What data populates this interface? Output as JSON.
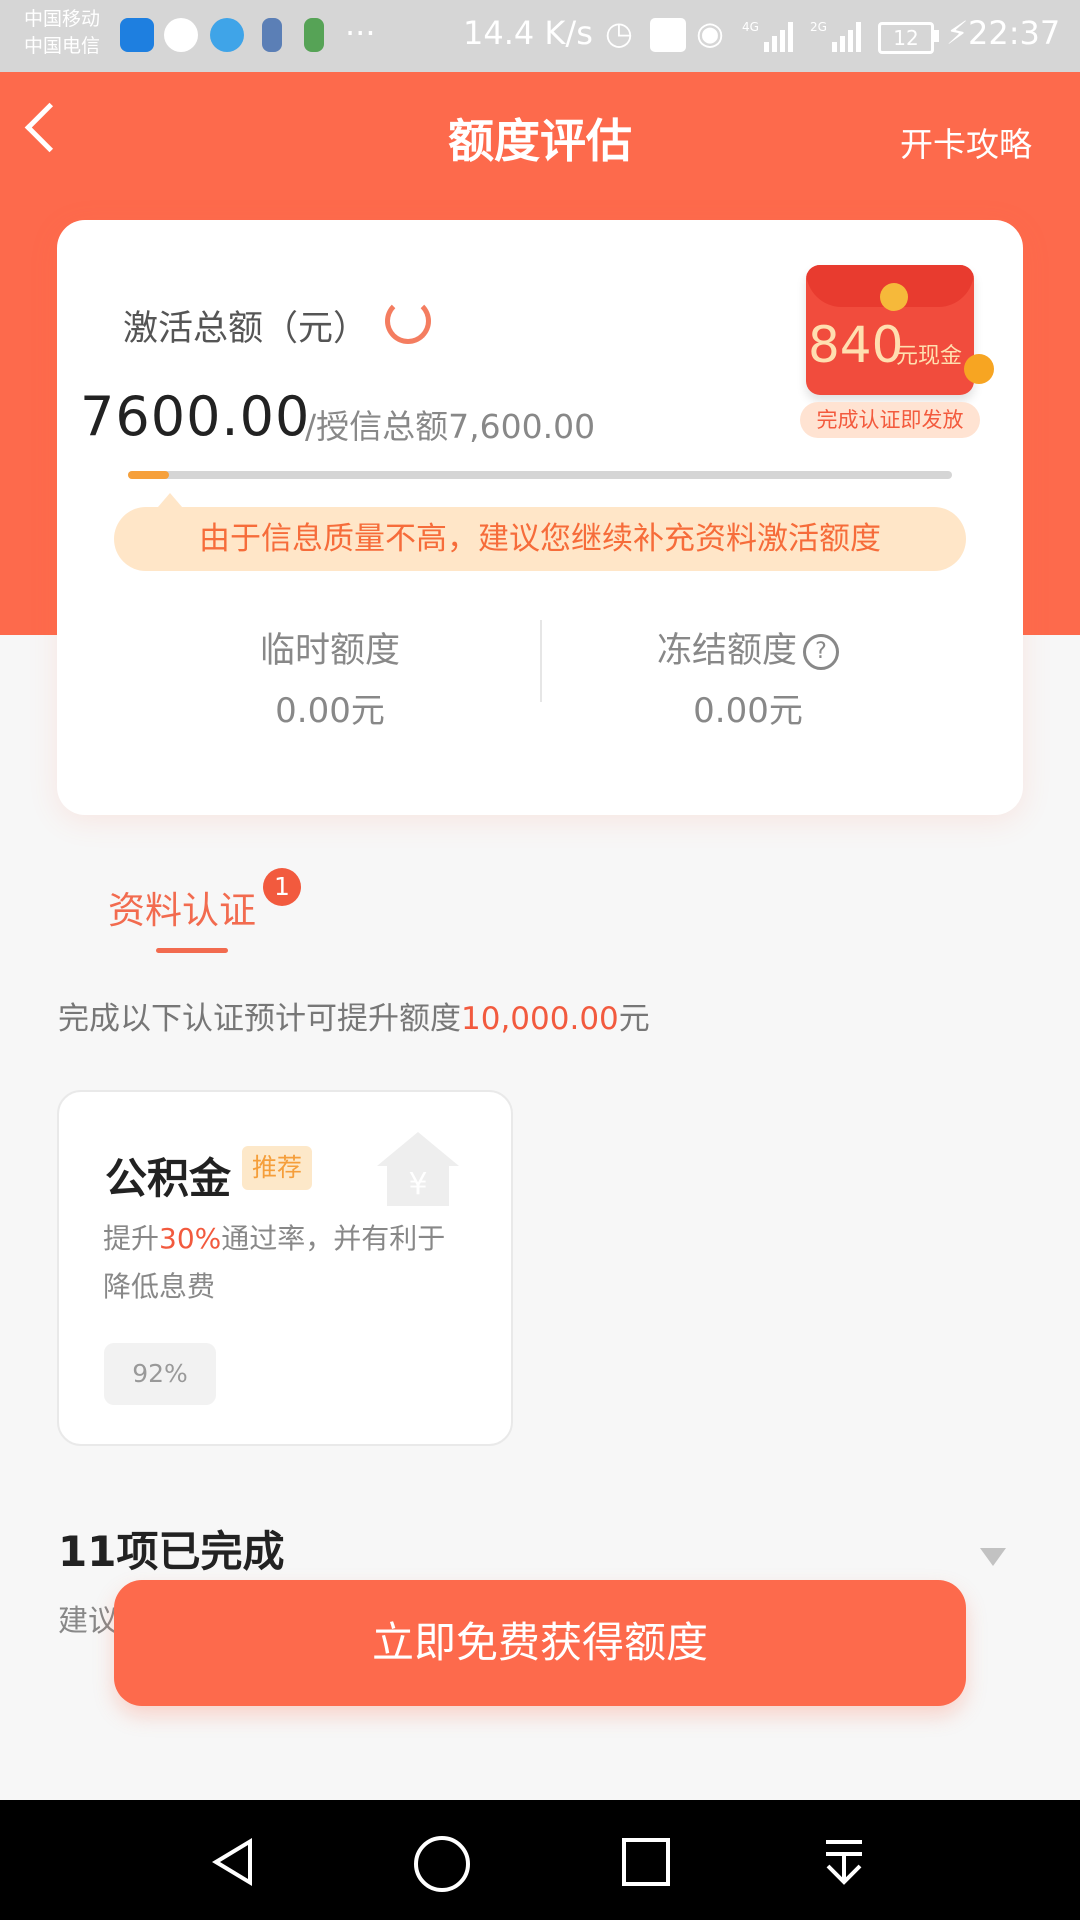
{
  "status_bar": {
    "carrier_1": "中国移动",
    "carrier_2": "中国电信",
    "network_speed": "14.4 K/s",
    "battery": "12",
    "time": "22:37",
    "signal_1_label": "4G",
    "signal_2_label": "2G"
  },
  "header": {
    "title": "额度评估",
    "right_link": "开卡攻略"
  },
  "summary": {
    "label": "激活总额（元）",
    "amount": "7600.00",
    "amount_sub": "/授信总额7,600.00",
    "progress_fraction": 0.05,
    "tip": "由于信息质量不高，建议您继续补充资料激活额度",
    "red_packet_amount": "840",
    "red_packet_unit": "元现金",
    "red_packet_badge": "完成认证即发放",
    "temp_label": "临时额度",
    "temp_value": "0.00元",
    "frozen_label": "冻结额度",
    "frozen_value": "0.00元"
  },
  "section": {
    "tab_label": "资料认证",
    "tab_badge": "1",
    "desc_prefix": "完成以下认证预计可提升额度",
    "desc_amount": "10,000.00",
    "desc_suffix": "元"
  },
  "item": {
    "title": "公积金",
    "tag": "推荐",
    "desc_prefix": "提升",
    "desc_highlight": "30%",
    "desc_suffix": "通过率，并有利于降低息费",
    "percent": "92%"
  },
  "completed": {
    "title": "11项已完成",
    "subtitle": "建议"
  },
  "cta": {
    "label": "立即免费获得额度"
  },
  "colors": {
    "brand": "#fd6a4c",
    "highlight": "#f25a3e",
    "progress": "#f6a03b"
  }
}
